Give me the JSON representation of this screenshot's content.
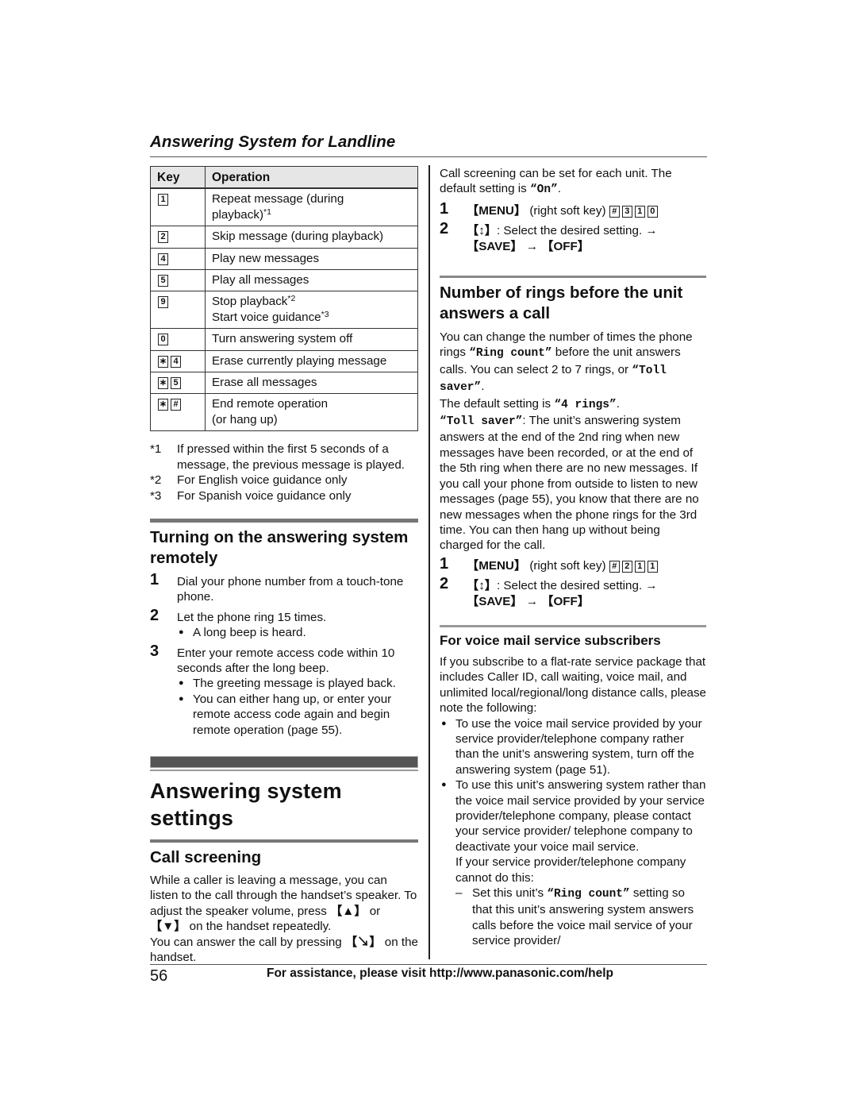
{
  "header": {
    "title": "Answering System for Landline"
  },
  "key_table": {
    "headers": [
      "Key",
      "Operation"
    ],
    "rows": [
      {
        "keys": [
          "1"
        ],
        "operation": [
          "Repeat message (during",
          "playback)"
        ],
        "sup": [
          "",
          "*1"
        ]
      },
      {
        "keys": [
          "2"
        ],
        "operation": [
          "Skip message (during playback)"
        ],
        "sup": [
          ""
        ]
      },
      {
        "keys": [
          "4"
        ],
        "operation": [
          "Play new messages"
        ],
        "sup": [
          ""
        ]
      },
      {
        "keys": [
          "5"
        ],
        "operation": [
          "Play all messages"
        ],
        "sup": [
          ""
        ]
      },
      {
        "keys": [
          "9"
        ],
        "operation": [
          "Stop playback",
          "Start voice guidance"
        ],
        "sup": [
          "*2",
          "*3"
        ]
      },
      {
        "keys": [
          "0"
        ],
        "operation": [
          "Turn answering system off"
        ],
        "sup": [
          ""
        ]
      },
      {
        "keys": [
          "*",
          "4"
        ],
        "operation": [
          "Erase currently playing message"
        ],
        "sup": [
          ""
        ]
      },
      {
        "keys": [
          "*",
          "5"
        ],
        "operation": [
          "Erase all messages"
        ],
        "sup": [
          ""
        ]
      },
      {
        "keys": [
          "*",
          "#"
        ],
        "operation": [
          "End remote operation",
          "(or hang up)"
        ],
        "sup": [
          "",
          ""
        ]
      }
    ]
  },
  "footnotes": [
    {
      "mark": "*1",
      "text": "If pressed within the first 5 seconds of a message, the previous message is played."
    },
    {
      "mark": "*2",
      "text": "For English voice guidance only"
    },
    {
      "mark": "*3",
      "text": "For Spanish voice guidance only"
    }
  ],
  "remote_section": {
    "heading": "Turning on the answering system remotely",
    "steps": [
      {
        "num": "1",
        "text": "Dial your phone number from a touch-tone phone.",
        "bullets": []
      },
      {
        "num": "2",
        "text": "Let the phone ring 15 times.",
        "bullets": [
          "A long beep is heard."
        ]
      },
      {
        "num": "3",
        "text": "Enter your remote access code within 10 seconds after the long beep.",
        "bullets": [
          "The greeting message is played back.",
          "You can either hang up, or enter your remote access code again and begin remote operation (page 55)."
        ]
      }
    ]
  },
  "settings_section": {
    "heading": "Answering system settings",
    "call_screening": {
      "heading": "Call screening",
      "para1_a": "While a caller is leaving a message, you can listen to the call through the handset’s speaker. To adjust the speaker volume, press ",
      "vol_up_key": "【▲】",
      "para1_b": " or ",
      "vol_down_key": "【▼】",
      "para1_c": " on the handset repeatedly.",
      "para2_a": "You can answer the call by pressing ",
      "talk_key": "【↘】",
      "para2_b": " on the handset.",
      "para3_a": "Call screening can be set for each unit. The default setting is ",
      "default_value": "“On”",
      "para3_b": ".",
      "steps": [
        {
          "num": "1",
          "menu": "【MENU】",
          "text": " (right soft key) ",
          "keys": [
            "#",
            "3",
            "1",
            "0"
          ]
        },
        {
          "num": "2",
          "nav": "【↕】",
          "text": ": Select the desired setting. → ",
          "save": "【SAVE】",
          "arrow": " → ",
          "off": "【OFF】"
        }
      ]
    },
    "rings": {
      "heading": "Number of rings before the unit answers a call",
      "p1_a": "You can change the number of times the phone rings ",
      "p1_m1": "“Ring count”",
      "p1_b": " before the unit answers calls. You can select 2 to 7 rings, or ",
      "p1_m2": "“Toll saver”",
      "p1_c": ".",
      "p2_a": "The default setting is ",
      "p2_m": "“4 rings”",
      "p2_b": ".",
      "p3_m": "“Toll saver”",
      "p3_text": ": The unit’s answering system answers at the end of the 2nd ring when new messages have been recorded, or at the end of the 5th ring when there are no new messages. If you call your phone from outside to listen to new messages (page 55), you know that there are no new messages when the phone rings for the 3rd time. You can then hang up without being charged for the call.",
      "steps": [
        {
          "num": "1",
          "menu": "【MENU】",
          "text": " (right soft key) ",
          "keys": [
            "#",
            "2",
            "1",
            "1"
          ]
        },
        {
          "num": "2",
          "nav": "【↕】",
          "text": ": Select the desired setting. → ",
          "save": "【SAVE】",
          "arrow": " → ",
          "off": "【OFF】"
        }
      ]
    },
    "voicemail": {
      "heading": "For voice mail service subscribers",
      "intro": "If you subscribe to a flat-rate service package that includes Caller ID, call waiting, voice mail, and unlimited local/regional/long distance calls, please note the following:",
      "bullets": [
        "To use the voice mail service provided by your service provider/telephone company rather than the unit’s answering system, turn off the answering system (page 51).",
        "To use this unit’s answering system rather than the voice mail service provided by your service provider/telephone company, please contact your service provider/ telephone company to deactivate your voice mail service."
      ],
      "followup": "If your service provider/telephone company cannot do this:",
      "dash_mark": "–",
      "dash_a": "Set this unit’s ",
      "dash_m": "“Ring count”",
      "dash_b": " setting so that this unit’s answering system answers calls before the voice mail service of your service provider/"
    }
  },
  "footer": {
    "page_number": "56",
    "text": "For assistance, please visit http://www.panasonic.com/help"
  }
}
